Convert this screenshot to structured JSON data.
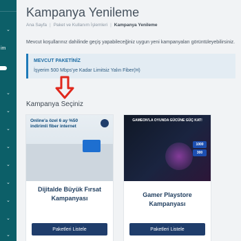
{
  "sidebar": {
    "menu_label": "im",
    "chevrons": [
      "⌄",
      "⌄",
      "⌄",
      "⌄",
      "⌄",
      "⌄",
      "⌄",
      "⌄",
      "⌄",
      "⌄"
    ]
  },
  "page": {
    "title": "Kampanya Yenileme"
  },
  "breadcrumb": {
    "items": [
      "Ana Sayfa",
      "Paket ve Kullanım İşlemleri",
      "Kampanya Yenileme"
    ]
  },
  "info_text": "Mevcut koşullarınız dahilinde geçiş yapabileceğiniz uygun yeni kampanyaları görüntüleyebilirsiniz.",
  "current_package": {
    "label": "MEVCUT PAKETİNİZ",
    "value": "İşyerim 500 Mbps'ye Kadar Limitsiz Yalın Fiber(H)"
  },
  "section_title": "Kampanya Seçiniz",
  "campaigns": [
    {
      "name": "Dijitalde Büyük Fırsat Kampanyası",
      "button_label": "Paketleri Listele",
      "image": {
        "headline_line1": "Online'a özel 6 ay %50",
        "headline_line2": "indirimli fiber internet"
      }
    },
    {
      "name": "Gamer Playstore Kampanyası",
      "button_label": "Paketleri Listele",
      "image": {
        "headline": "GAMEON'LA OYUNDA GÜCÜNE GÜÇ KAT!",
        "badge_1": "1000",
        "badge_2": "300"
      }
    }
  ],
  "colors": {
    "sidebar": "#0c5f68",
    "accent_blue": "#1c78b8",
    "button": "#1f3d6b",
    "arrow": "#e0271c"
  }
}
